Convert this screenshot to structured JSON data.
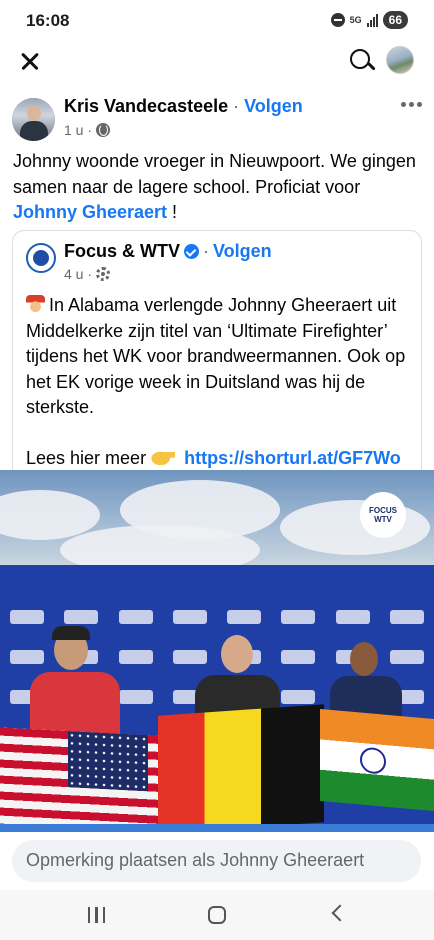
{
  "status_bar": {
    "time": "16:08",
    "network": "5G",
    "battery": "66"
  },
  "top_bar": {
    "close_icon": "close-icon",
    "search_icon": "search-icon"
  },
  "post": {
    "author": "Kris Vandecasteele",
    "separator": " · ",
    "follow": "Volgen",
    "time": "1 u ·",
    "text_before": "Johnny woonde vroeger in Nieuwpoort. We gingen samen naar de lagere school. Proficiat voor ",
    "mention": "Johnny Gheeraert",
    "text_after": " !"
  },
  "shared": {
    "page_name": "Focus & WTV",
    "follow": "Volgen",
    "separator": "·",
    "time": "4 u ·",
    "text_line": "In Alabama verlengde Johnny Gheeraert uit Middelkerke zijn titel van ‘Ultimate Firefighter’ tijdens het WK voor brandweermannen. Ook op het EK vorige week in Duitsland was hij de sterkste.",
    "read_more": "Lees hier meer",
    "link": "https://shorturl.at/GF7Wo"
  },
  "photo": {
    "badge_line1": "FOCUS",
    "badge_line2": "WTV"
  },
  "comment": {
    "placeholder": "Opmerking plaatsen als Johnny Gheeraert"
  },
  "colors": {
    "link_blue": "#1877f2",
    "secondary_text": "#65676b",
    "input_bg": "#f0f2f5"
  }
}
